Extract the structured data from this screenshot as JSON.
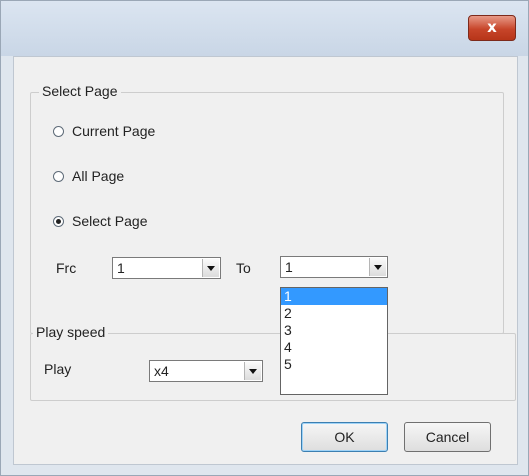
{
  "window": {
    "close_label": "x"
  },
  "select_page_group": {
    "title": "Select Page",
    "options": [
      {
        "label": "Current Page",
        "checked": false
      },
      {
        "label": "All Page",
        "checked": false
      },
      {
        "label": "Select Page",
        "checked": true
      }
    ],
    "from_label": "Frc",
    "from_value": "1",
    "to_label": "To",
    "to_value": "1",
    "to_options": [
      "1",
      "2",
      "3",
      "4",
      "5"
    ],
    "to_selected_index": 0
  },
  "play_speed_group": {
    "title": "Play speed",
    "play_label": "Play",
    "play_value": "x4"
  },
  "buttons": {
    "ok": "OK",
    "cancel": "Cancel"
  },
  "colors": {
    "close_button": "#c7452a",
    "selection": "#3399ff"
  }
}
